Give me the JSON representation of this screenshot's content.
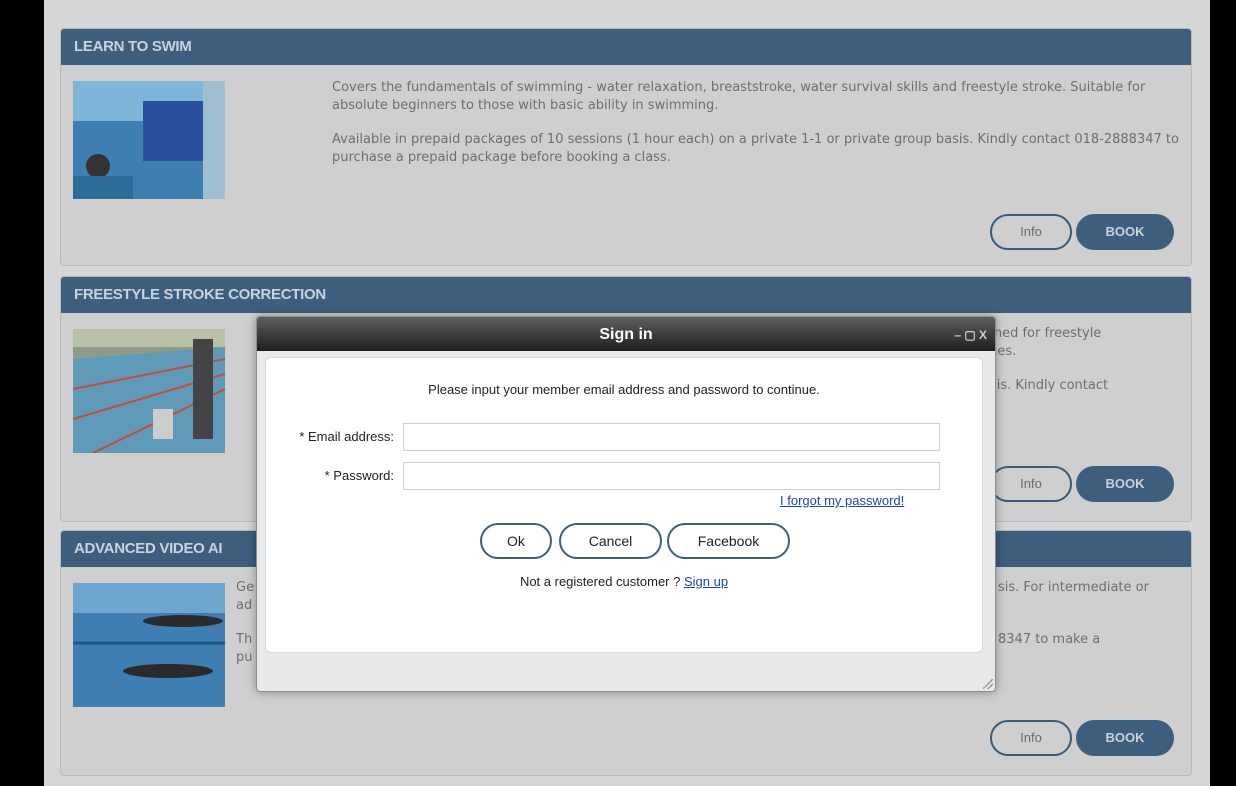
{
  "cards": [
    {
      "title": "LEARN TO SWIM",
      "para1": "Covers the fundamentals of swimming - water relaxation, breaststroke, water survival skills and freestyle stroke. Suitable for absolute beginners to those with basic ability in swimming.",
      "para2": "Available in prepaid packages of 10 sessions (1 hour each) on a private 1-1 or private group basis. Kindly contact 018-2888347 to purchase a prepaid package before booking a class.",
      "info": "Info",
      "book": "BOOK"
    },
    {
      "title": "FREESTYLE STROKE CORRECTION",
      "para1": "igned for freestyle",
      "para1b": "nces.",
      "para2": "asis. Kindly contact",
      "info": "Info",
      "book": "BOOK"
    },
    {
      "title": "ADVANCED VIDEO AI",
      "para1a": "Ge",
      "para1b": "ad",
      "para1c": "sis. For intermediate or",
      "para2a": "Th",
      "para2b": "pu",
      "para2c": "8347 to make a",
      "info": "Info",
      "book": "BOOK"
    }
  ],
  "dialog": {
    "title": "Sign in",
    "controls": "– ▢ X",
    "prompt": "Please input your member email address and password to continue.",
    "email_label": "* Email address:",
    "email_value": "",
    "password_label": "* Password:",
    "password_value": "",
    "forgot_link": "I forgot my password!",
    "ok": "Ok",
    "cancel": "Cancel",
    "facebook": "Facebook",
    "register_text": "Not a registered customer ?",
    "signup_link": "Sign up"
  }
}
